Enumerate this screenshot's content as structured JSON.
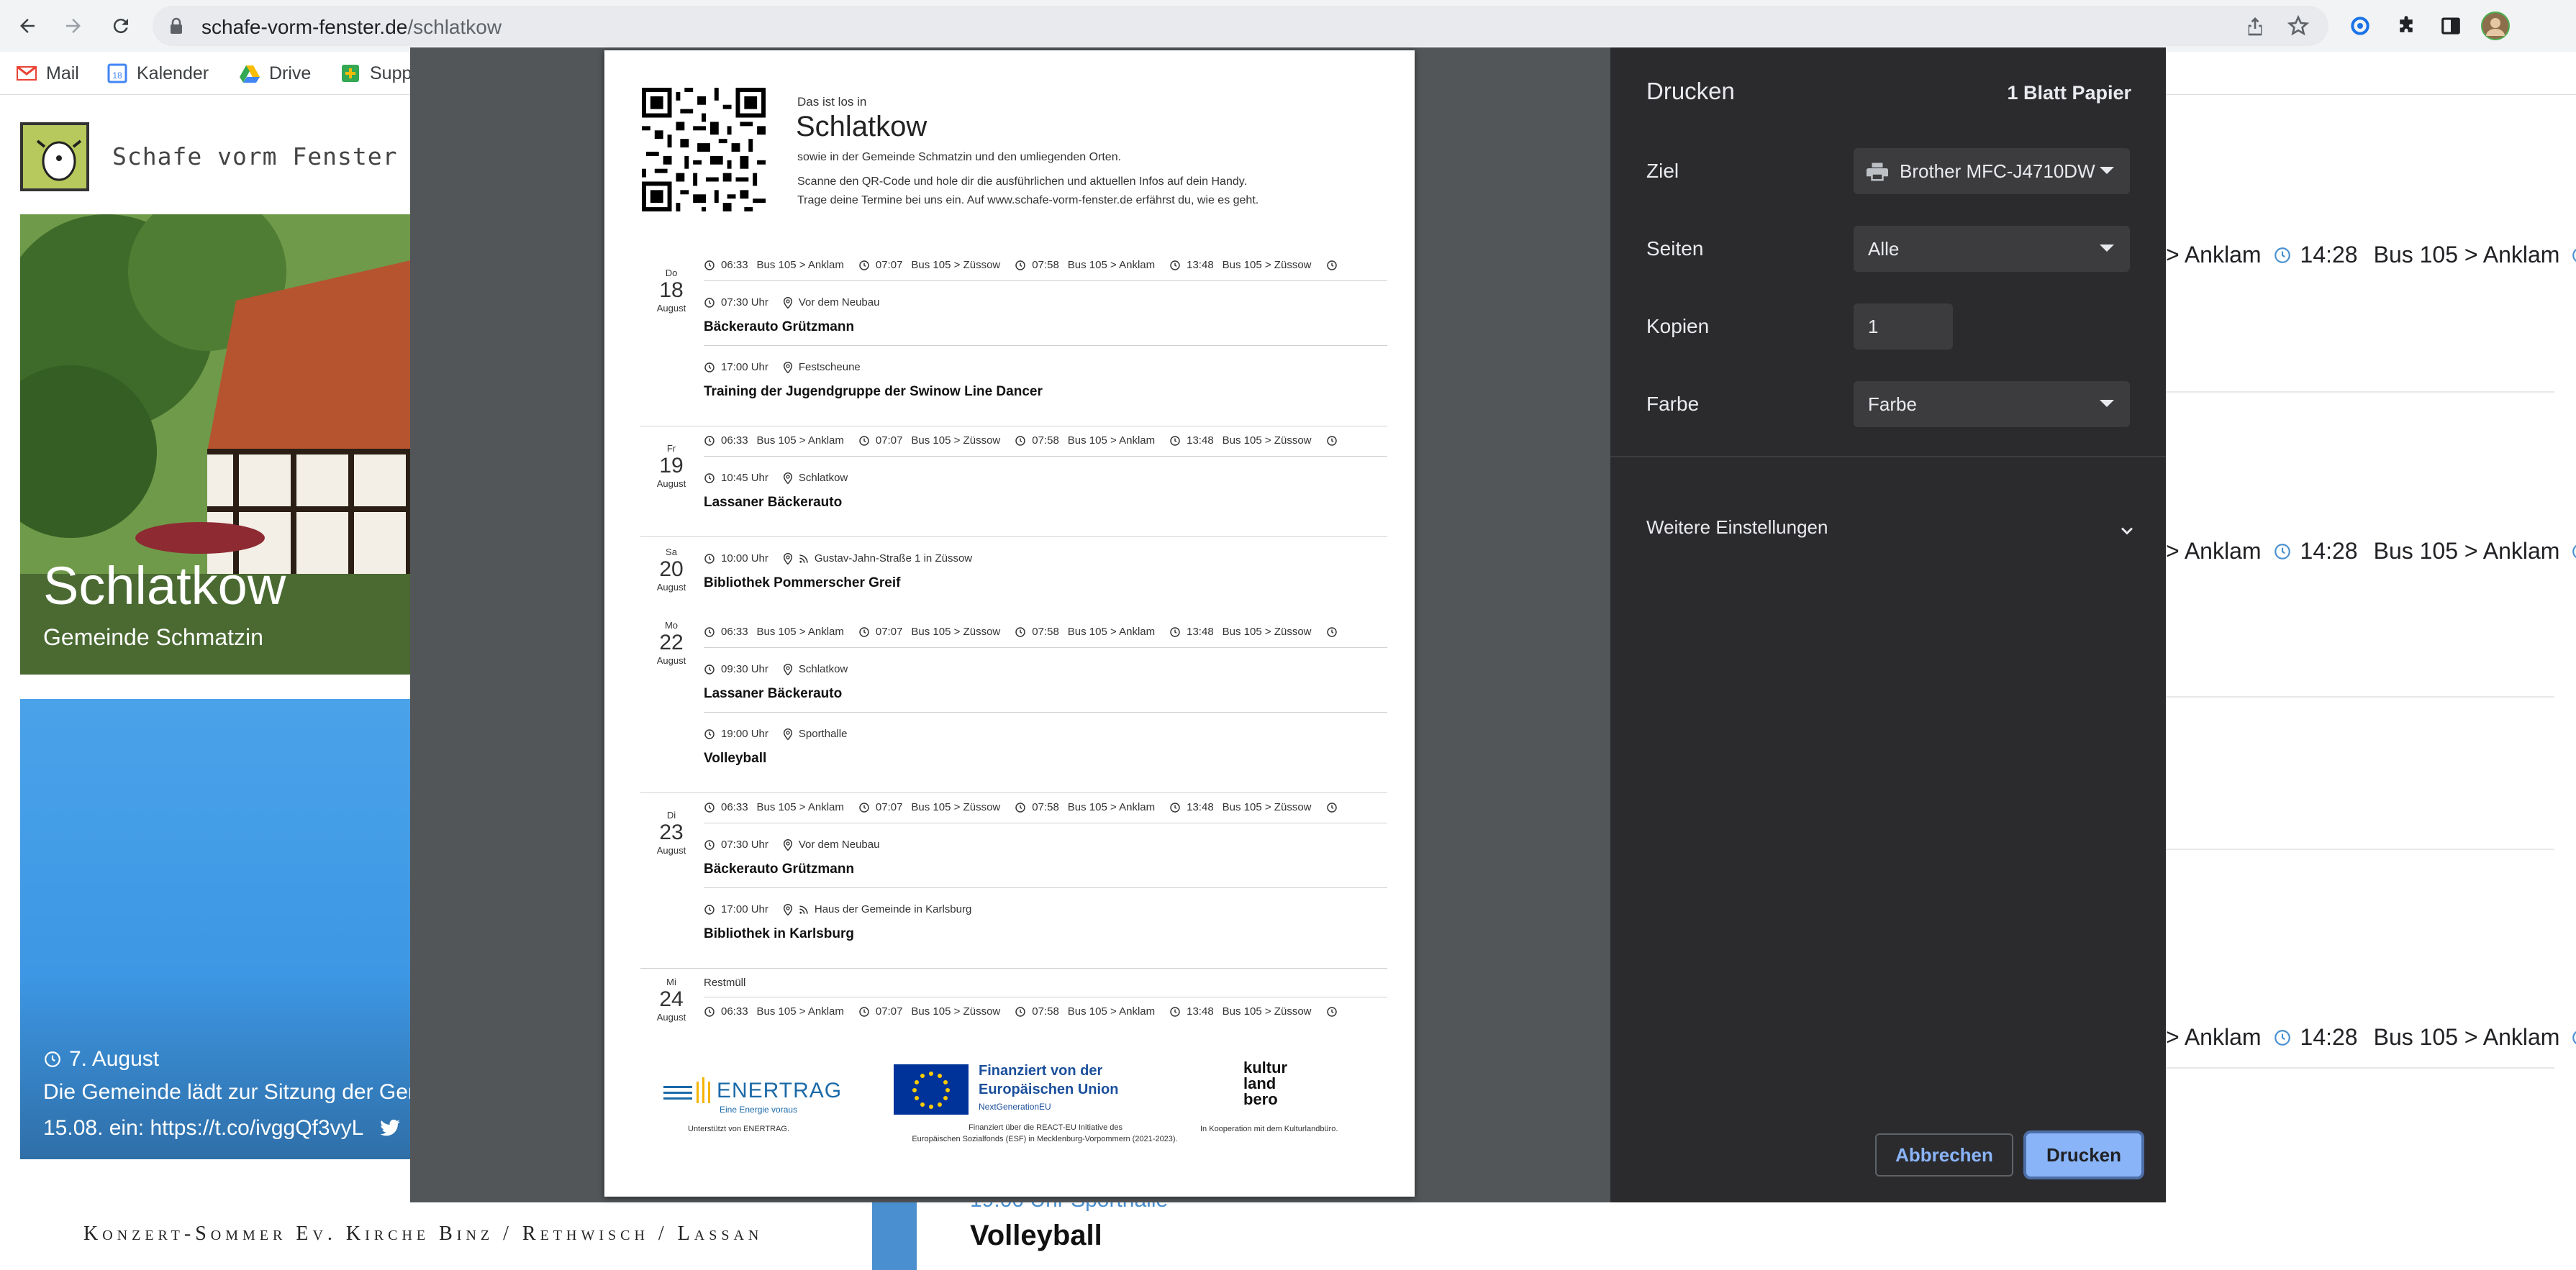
{
  "browser": {
    "url_host": "schafe-vorm-fenster.de",
    "url_path": "/schlatkow",
    "bookmarks": [
      "Mail",
      "Kalender",
      "Drive",
      "Supp"
    ]
  },
  "site": {
    "brand": "Schafe vorm Fenster",
    "hero_title": "Schlatkow",
    "hero_subtitle": "Gemeinde Schmatzin",
    "news_date": "7. August",
    "news_line1": "Die Gemeinde lädt zur Sitzung der Geme",
    "news_line2": "15.08. ein: https://t.co/ivggQf3vyL",
    "konzert": "Konzert-Sommer   Ev. Kirche Binz  /  Rethwisch  /  Lassan",
    "bg_event_meta": "19:00 Uhr      Sporthalle",
    "bg_event": "Volleyball",
    "right_rows": [
      {
        "a": "> Anklam",
        "time": "14:28",
        "b": "Bus 105 > Anklam"
      },
      {
        "a": "> Anklam",
        "time": "14:28",
        "b": "Bus 105 > Anklam"
      },
      {
        "a": "> Anklam",
        "time": "14:28",
        "b": "Bus 105 > Anklam"
      }
    ]
  },
  "preview": {
    "pre": "Das ist los in",
    "title": "Schlatkow",
    "line1": "sowie in der Gemeinde Schmatzin und den umliegenden Orten.",
    "line2": "Scanne den QR-Code und hole dir die ausführlichen und aktuellen Infos auf dein Handy.",
    "line3": "Trage deine Termine bei uns ein. Auf www.schafe-vorm-fenster.de erfährst du, wie es geht.",
    "bus": [
      "06:33",
      "Bus 105 > Anklam",
      "07:07",
      "Bus 105 > Züssow",
      "07:58",
      "Bus 105 > Anklam",
      "13:48",
      "Bus 105 > Züssow"
    ],
    "days": [
      {
        "wd": "Do",
        "dn": "18",
        "mo": "August"
      },
      {
        "wd": "Fr",
        "dn": "19",
        "mo": "August"
      },
      {
        "wd": "Sa",
        "dn": "20",
        "mo": "August"
      },
      {
        "wd": "Mo",
        "dn": "22",
        "mo": "August"
      },
      {
        "wd": "Di",
        "dn": "23",
        "mo": "August"
      },
      {
        "wd": "Mi",
        "dn": "24",
        "mo": "August"
      }
    ],
    "events": [
      {
        "time": "07:30 Uhr",
        "place": "Vor dem Neubau",
        "title": "Bäckerauto Grützmann"
      },
      {
        "time": "17:00 Uhr",
        "place": "Festscheune",
        "title": "Training der Jugendgruppe der Swinow Line Dancer"
      },
      {
        "time": "10:45 Uhr",
        "place": "Schlatkow",
        "title": "Lassaner Bäckerauto"
      },
      {
        "time": "10:00 Uhr",
        "place": "Gustav-Jahn-Straße 1 in Züssow",
        "title": "Bibliothek Pommerscher Greif"
      },
      {
        "time": "09:30 Uhr",
        "place": "Schlatkow",
        "title": "Lassaner Bäckerauto"
      },
      {
        "time": "19:00 Uhr",
        "place": "Sporthalle",
        "title": "Volleyball"
      },
      {
        "time": "07:30 Uhr",
        "place": "Vor dem Neubau",
        "title": "Bäckerauto Grützmann"
      },
      {
        "time": "17:00 Uhr",
        "place": "Haus der Gemeinde in Karlsburg",
        "title": "Bibliothek in Karlsburg"
      }
    ],
    "restmuell": "Restmüll",
    "footer": {
      "enertrag": "ENERTRAG",
      "enertrag_tag": "Eine Energie voraus",
      "enertrag_note": "Unterstützt von ENERTRAG.",
      "eu1": "Finanziert von der",
      "eu2": "Europäischen Union",
      "eu3": "NextGenerationEU",
      "eu_note1": "Finanziert über die REACT-EU Initiative des",
      "eu_note2": "Europäischen Sozialfonds (ESF) in Mecklenburg-Vorpommern (2021-2023).",
      "kb1": "kultur",
      "kb2": "land",
      "kb3": "bero",
      "kb_note": "In Kooperation mit dem Kulturlandbüro."
    }
  },
  "print": {
    "title": "Drucken",
    "sheets": "1 Blatt Papier",
    "dest_label": "Ziel",
    "dest_value": "Brother MFC-J4710DW",
    "pages_label": "Seiten",
    "pages_value": "Alle",
    "copies_label": "Kopien",
    "copies_value": "1",
    "color_label": "Farbe",
    "color_value": "Farbe",
    "more": "Weitere Einstellungen",
    "cancel": "Abbrechen",
    "print": "Drucken"
  },
  "colors": {
    "accent": "#8ab4f8",
    "panel": "#2b2b2e",
    "preview_bg": "#525659"
  }
}
